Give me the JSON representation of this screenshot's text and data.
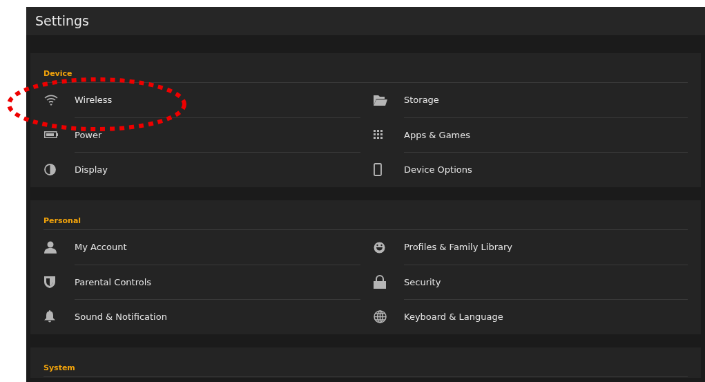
{
  "header": {
    "title": "Settings"
  },
  "sections": [
    {
      "title": "Device",
      "items": [
        {
          "label": "Wireless"
        },
        {
          "label": "Storage"
        },
        {
          "label": "Power"
        },
        {
          "label": "Apps & Games"
        },
        {
          "label": "Display"
        },
        {
          "label": "Device Options"
        }
      ]
    },
    {
      "title": "Personal",
      "items": [
        {
          "label": "My Account"
        },
        {
          "label": "Profiles & Family Library"
        },
        {
          "label": "Parental Controls"
        },
        {
          "label": "Security"
        },
        {
          "label": "Sound & Notification"
        },
        {
          "label": "Keyboard & Language"
        }
      ]
    },
    {
      "title": "System"
    }
  ]
}
